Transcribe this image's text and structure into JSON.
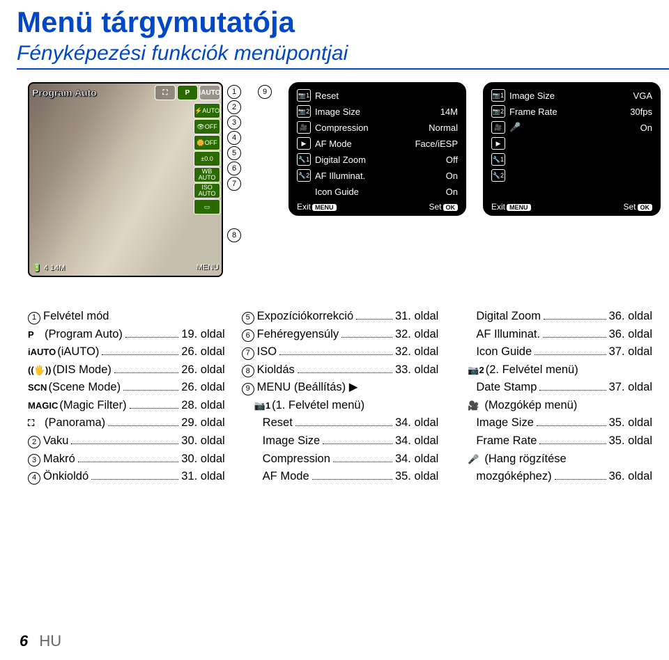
{
  "header": {
    "title": "Menü tárgymutatója",
    "subtitle": "Fényképezési funkciók menüpontjai"
  },
  "camera": {
    "mode_label": "Program Auto",
    "mode_boxes": [
      "⛶",
      "P",
      "iAUTO"
    ],
    "side_chips": [
      "⚡AUTO",
      "👁OFF",
      "🌼OFF",
      "±0.0",
      "WB AUTO",
      "ISO AUTO",
      "▭"
    ],
    "bottom_left": "🔋 4 14M",
    "bottom_right": "MENU"
  },
  "markers_v": [
    "1",
    "2",
    "3",
    "4",
    "5",
    "6",
    "7",
    "8"
  ],
  "marker9": "9",
  "menu1": {
    "rows": [
      {
        "icon": "📷1",
        "label": "Reset",
        "val": ""
      },
      {
        "icon": "📷2",
        "label": "Image Size",
        "val": "14M"
      },
      {
        "icon": "🎥",
        "label": "Compression",
        "val": "Normal"
      },
      {
        "icon": "▶",
        "label": "AF Mode",
        "val": "Face/iESP"
      },
      {
        "icon": "🔧1",
        "label": "Digital Zoom",
        "val": "Off"
      },
      {
        "icon": "🔧2",
        "label": "AF Illuminat.",
        "val": "On"
      },
      {
        "icon": "",
        "label": "Icon Guide",
        "val": "On"
      }
    ],
    "exit": "Exit",
    "exit_btn": "MENU",
    "set": "Set",
    "set_btn": "OK"
  },
  "menu2": {
    "rows": [
      {
        "icon": "📷1",
        "label": "Image Size",
        "val": "VGA"
      },
      {
        "icon": "📷2",
        "label": "Frame Rate",
        "val": "30fps"
      },
      {
        "icon": "🎥",
        "label": "🎤",
        "val": "On"
      },
      {
        "icon": "▶",
        "label": "",
        "val": ""
      },
      {
        "icon": "🔧1",
        "label": "",
        "val": ""
      },
      {
        "icon": "🔧2",
        "label": "",
        "val": ""
      }
    ],
    "exit": "Exit",
    "exit_btn": "MENU",
    "set": "Set",
    "set_btn": "OK"
  },
  "index": {
    "col1": [
      {
        "num": "1",
        "icon": "",
        "label": "Felvétel mód",
        "page": ""
      },
      {
        "num": "",
        "icon": "P",
        "label": "(Program Auto)",
        "page": "19. oldal"
      },
      {
        "num": "",
        "icon": "iAUTO",
        "label": "(iAUTO)",
        "page": "26. oldal"
      },
      {
        "num": "",
        "icon": "((🖐))",
        "label": "(DIS Mode)",
        "page": "26. oldal"
      },
      {
        "num": "",
        "icon": "SCN",
        "label": "(Scene Mode)",
        "page": "26. oldal"
      },
      {
        "num": "",
        "icon": "MAGIC",
        "label": "(Magic Filter)",
        "page": "28. oldal"
      },
      {
        "num": "",
        "icon": "⛶",
        "label": "(Panorama)",
        "page": "29. oldal"
      },
      {
        "num": "2",
        "icon": "",
        "label": "Vaku",
        "page": "30. oldal"
      },
      {
        "num": "3",
        "icon": "",
        "label": "Makró",
        "page": "30. oldal"
      },
      {
        "num": "4",
        "icon": "",
        "label": "Önkioldó",
        "page": "31. oldal"
      }
    ],
    "col2": [
      {
        "num": "5",
        "icon": "",
        "label": "Expozíciókorrekció",
        "page": "31. oldal"
      },
      {
        "num": "6",
        "icon": "",
        "label": "Fehéregyensúly",
        "page": "32. oldal"
      },
      {
        "num": "7",
        "icon": "",
        "label": "ISO",
        "page": "32. oldal"
      },
      {
        "num": "8",
        "icon": "",
        "label": "Kioldás",
        "page": "33. oldal"
      },
      {
        "num": "9",
        "icon": "",
        "label": "MENU (Beállítás) ▶",
        "page": "",
        "nohdr": true
      },
      {
        "num": "",
        "icon": "📷1",
        "label": "(1. Felvétel menü)",
        "page": "",
        "sub": true
      },
      {
        "num": "",
        "icon": "",
        "label": "Reset",
        "page": "34. oldal",
        "sub2": true
      },
      {
        "num": "",
        "icon": "",
        "label": "Image Size",
        "page": "34. oldal",
        "sub2": true
      },
      {
        "num": "",
        "icon": "",
        "label": "Compression",
        "page": "34. oldal",
        "sub2": true
      },
      {
        "num": "",
        "icon": "",
        "label": "AF Mode",
        "page": "35. oldal",
        "sub2": true
      }
    ],
    "col3": [
      {
        "num": "",
        "icon": "",
        "label": "Digital Zoom",
        "page": "36. oldal",
        "sub2": true
      },
      {
        "num": "",
        "icon": "",
        "label": "AF Illuminat.",
        "page": "36. oldal",
        "sub2": true
      },
      {
        "num": "",
        "icon": "",
        "label": "Icon Guide",
        "page": "37. oldal",
        "sub2": true
      },
      {
        "num": "",
        "icon": "📷2",
        "label": "(2. Felvétel menü)",
        "page": "",
        "sub": true
      },
      {
        "num": "",
        "icon": "",
        "label": "Date Stamp",
        "page": "37. oldal",
        "sub2": true
      },
      {
        "num": "",
        "icon": "🎥",
        "label": "(Mozgókép menü)",
        "page": "",
        "sub": true
      },
      {
        "num": "",
        "icon": "",
        "label": "Image Size",
        "page": "35. oldal",
        "sub2": true
      },
      {
        "num": "",
        "icon": "",
        "label": "Frame Rate",
        "page": "35. oldal",
        "sub2": true
      },
      {
        "num": "",
        "icon": "🎤",
        "label": "(Hang rögzítése",
        "page": "",
        "sub": true
      },
      {
        "num": "",
        "icon": "",
        "label": "mozgóképhez)",
        "page": "36. oldal",
        "sub2": true
      }
    ]
  },
  "footer": {
    "page": "6",
    "lang": "HU"
  }
}
